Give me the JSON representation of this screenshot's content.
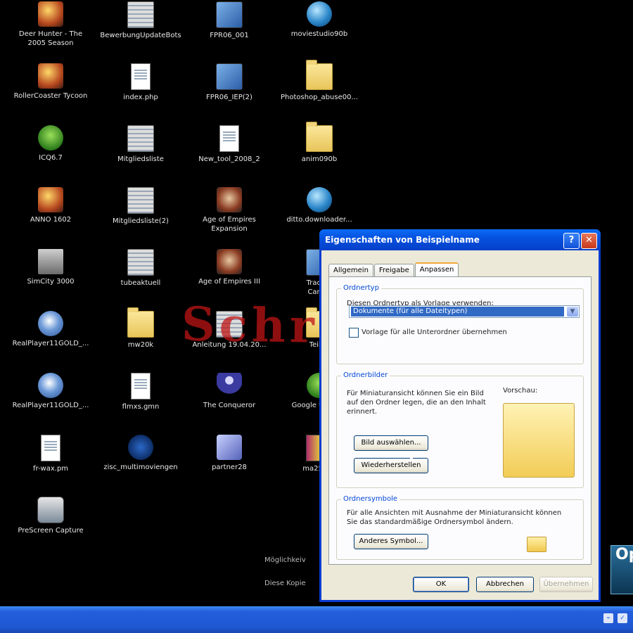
{
  "desktop": {
    "icons": [
      {
        "label": "Deer Hunter - The\n2005 Season",
        "icon": "game"
      },
      {
        "label": "BewerbungUpdateBots",
        "icon": "stack"
      },
      {
        "label": "FPR06_001",
        "icon": "setup"
      },
      {
        "label": "moviestudio90b",
        "icon": "globe"
      },
      {
        "label": "RollerCoaster Tycoon",
        "icon": "game"
      },
      {
        "label": "index.php",
        "icon": "doc"
      },
      {
        "label": "FPR06_IEP(2)",
        "icon": "setup"
      },
      {
        "label": "Photoshop_abuse00...",
        "icon": "folder"
      },
      {
        "label": "ICQ6.7",
        "icon": "green"
      },
      {
        "label": "Mitgliedsliste",
        "icon": "stack"
      },
      {
        "label": "New_tool_2008_2",
        "icon": "doc"
      },
      {
        "label": "anim090b",
        "icon": "folder"
      },
      {
        "label": "ANNO 1602",
        "icon": "game"
      },
      {
        "label": "Mitgliedsliste(2)",
        "icon": "stack"
      },
      {
        "label": "Age of Empires\nExpansion",
        "icon": "aoe"
      },
      {
        "label": "ditto.downloader...",
        "icon": "globe"
      },
      {
        "label": "SimCity 3000",
        "icon": "sim"
      },
      {
        "label": "tubeaktuell",
        "icon": "stack"
      },
      {
        "label": "Age of Empires III",
        "icon": "aoe"
      },
      {
        "label": "TrackTe\nCamer",
        "icon": "setup"
      },
      {
        "label": "RealPlayer11GOLD_...",
        "icon": "real"
      },
      {
        "label": "mw20k",
        "icon": "folder"
      },
      {
        "label": "Anleitung 19.04.20...",
        "icon": "stack"
      },
      {
        "label": "Teilgn",
        "icon": "folder"
      },
      {
        "label": "RealPlayer11GOLD_...",
        "icon": "real"
      },
      {
        "label": "flmxs.gmn",
        "icon": "doc"
      },
      {
        "label": "The Conqueror",
        "icon": "person"
      },
      {
        "label": "Google Updater",
        "icon": "green"
      },
      {
        "label": "fr-wax.pm",
        "icon": "doc"
      },
      {
        "label": "zisc_multimoviengen",
        "icon": "blue"
      },
      {
        "label": "partner28",
        "icon": "partner"
      },
      {
        "label": "ma25deu",
        "icon": "rar"
      },
      {
        "label": "PreScreen Capture",
        "icon": "cam"
      }
    ],
    "watermark": "Schritt 6:",
    "bg_text_1": "Möglichkeiv",
    "bg_text_2": "Diese Kopie",
    "popup_text": "Op"
  },
  "dialog": {
    "title": "Eigenschaften von Beispielname",
    "help_label": "?",
    "close_label": "✕",
    "tabs": [
      "Allgemein",
      "Freigabe",
      "Anpassen"
    ],
    "group1": {
      "title": "Ordnertyp",
      "text": "Diesen Ordnertyp als Vorlage verwenden:",
      "select_value": "Dokumente (für alle Dateitypen)",
      "checkbox_label": "Vorlage für alle Unterordner übernehmen"
    },
    "group2": {
      "title": "Ordnerbilder",
      "text": "Für Miniaturansicht können Sie ein Bild auf den Ordner legen, die an den Inhalt erinnert.",
      "preview_label": "Vorschau:",
      "choose_button": "Bild auswählen...",
      "restore_button": "Wiederherstellen"
    },
    "group3": {
      "title": "Ordnersymbole",
      "text": "Für alle Ansichten mit Ausnahme der Miniaturansicht können Sie das standardmäßige Ordnersymbol ändern.",
      "change_button": "Anderes Symbol..."
    },
    "buttons": {
      "ok": "OK",
      "cancel": "Abbrechen",
      "apply": "Übernehmen"
    }
  }
}
